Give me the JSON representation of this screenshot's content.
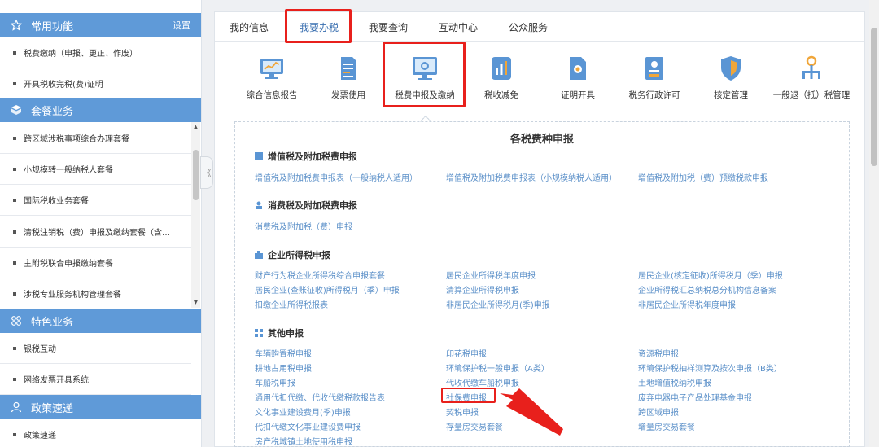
{
  "sidebar": {
    "sections": [
      {
        "title": "常用功能",
        "icon": "star-icon",
        "extra": "设置"
      },
      {
        "title": "套餐业务",
        "icon": "package-icon"
      },
      {
        "title": "特色业务",
        "icon": "grid-icon"
      },
      {
        "title": "政策速递",
        "icon": "user-icon"
      }
    ],
    "common_items": [
      "税费缴纳（申报、更正、作废）",
      "开具税收完税(费)证明"
    ],
    "package_items": [
      "跨区域涉税事项综合办理套餐",
      "小规模转一般纳税人套餐",
      "国际税收业务套餐",
      "清税注销税（费）申报及缴纳套餐（含…",
      "主附税联合申报缴纳套餐",
      "涉税专业服务机构管理套餐"
    ],
    "feature_items": [
      "银税互动",
      "网络发票开具系统"
    ],
    "policy_items": [
      "政策速递"
    ]
  },
  "collapse_label": "《",
  "tabs": [
    "我的信息",
    "我要办税",
    "我要查询",
    "互动中心",
    "公众服务"
  ],
  "functions": [
    {
      "label": "综合信息报告",
      "icon": "monitor-chart-icon"
    },
    {
      "label": "发票使用",
      "icon": "invoice-icon"
    },
    {
      "label": "税费申报及缴纳",
      "icon": "tax-declare-icon"
    },
    {
      "label": "税收减免",
      "icon": "tax-relief-icon"
    },
    {
      "label": "证明开具",
      "icon": "certificate-icon"
    },
    {
      "label": "税务行政许可",
      "icon": "license-icon"
    },
    {
      "label": "核定管理",
      "icon": "shield-icon"
    },
    {
      "label": "一般退（抵）税管理",
      "icon": "refund-icon"
    }
  ],
  "panel": {
    "title": "各税费种申报",
    "categories": [
      {
        "title": "增值税及附加税费申报",
        "links": [
          "增值税及附加税费申报表（一般纳税人适用）",
          "增值税及附加税费申报表（小规模纳税人适用）",
          "增值税及附加税（费）预缴税款申报"
        ]
      },
      {
        "title": "消费税及附加税费申报",
        "links": [
          "消费税及附加税（费）申报"
        ]
      },
      {
        "title": "企业所得税申报",
        "links": [
          "财产行为税企业所得税综合申报套餐",
          "居民企业所得税年度申报",
          "居民企业(核定征收)所得税月（季）申报",
          "居民企业(查账征收)所得税月（季）申报",
          "清算企业所得税申报",
          "企业所得税汇总纳税总分机构信息备案",
          "扣缴企业所得税报表",
          "非居民企业所得税月(季)申报",
          "非居民企业所得税年度申报"
        ]
      },
      {
        "title": "其他申报",
        "links": [
          "车辆购置税申报",
          "印花税申报",
          "资源税申报",
          "耕地占用税申报",
          "环境保护税一般申报（A类）",
          "环境保护税抽样测算及按次申报（B类）",
          "车船税申报",
          "代收代缴车船税申报",
          "土地增值税纳税申报",
          "通用代扣代缴、代收代缴税款报告表",
          "社保费申报",
          "废弃电器电子产品处理基金申报",
          "文化事业建设费月(季)申报",
          "契税申报",
          "跨区域申报",
          "代扣代缴文化事业建设费申报",
          "存量房交易套餐",
          "增量房交易套餐",
          "房产税城镇土地使用税申报"
        ]
      }
    ]
  },
  "colors": {
    "accent": "#5f9ad8",
    "link": "#5a8fc8",
    "highlight": "#e8201c"
  }
}
